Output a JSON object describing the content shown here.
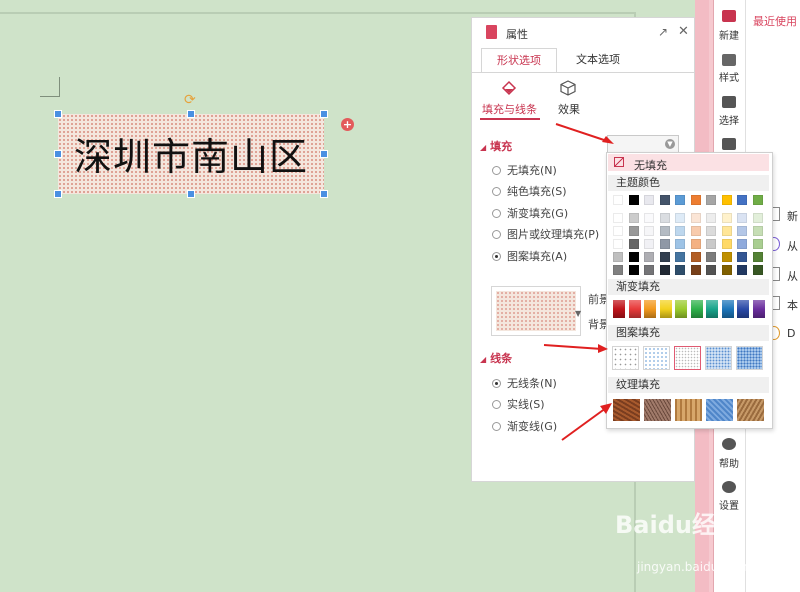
{
  "canvas": {
    "textbox_text": "深圳市南山区"
  },
  "panel": {
    "title": "属性",
    "tabs": [
      "形状选项",
      "文本选项"
    ],
    "subtabs": [
      "填充与线条",
      "效果"
    ],
    "fill_section": "填充",
    "fill_options": [
      "无填充(N)",
      "纯色填充(S)",
      "渐变填充(G)",
      "图片或纹理填充(P)",
      "图案填充(A)"
    ],
    "fill_selected": "图案填充(A)",
    "foreground_label": "前景",
    "background_label": "背景",
    "line_section": "线条",
    "line_options": [
      "无线条(N)",
      "实线(S)",
      "渐变线(G)"
    ],
    "line_selected": "无线条(N)"
  },
  "palette": {
    "no_fill": "无填充",
    "theme_colors_label": "主题颜色",
    "gradient_label": "渐变填充",
    "pattern_label": "图案填充",
    "texture_label": "纹理填充",
    "theme_top_row": [
      "#ffffff",
      "#000000",
      "#e8e8ee",
      "#44546a",
      "#5b9bd5",
      "#ed7d31",
      "#a5a5a5",
      "#ffc000",
      "#4472c4",
      "#70ad47"
    ],
    "gradient_colors": [
      "#c0141b",
      "#e83a3a",
      "#f39a1f",
      "#f3d21f",
      "#9ccc2e",
      "#2fb24b",
      "#19a58c",
      "#1d76bb",
      "#2a4aa8",
      "#6b2e9e"
    ]
  },
  "sidebar": {
    "items": [
      {
        "label": "新建",
        "icon": "new-doc-icon"
      },
      {
        "label": "样式",
        "icon": "style-icon"
      },
      {
        "label": "选择",
        "icon": "select-icon"
      },
      {
        "label": "帮助",
        "icon": "help-icon"
      },
      {
        "label": "设置",
        "icon": "gear-icon"
      }
    ],
    "recent": "最近使用",
    "far_items": [
      "新",
      "从",
      "从",
      "本",
      "D"
    ]
  },
  "watermark": {
    "main": "Baidu经验",
    "sub": "jingyan.baidu.com"
  }
}
